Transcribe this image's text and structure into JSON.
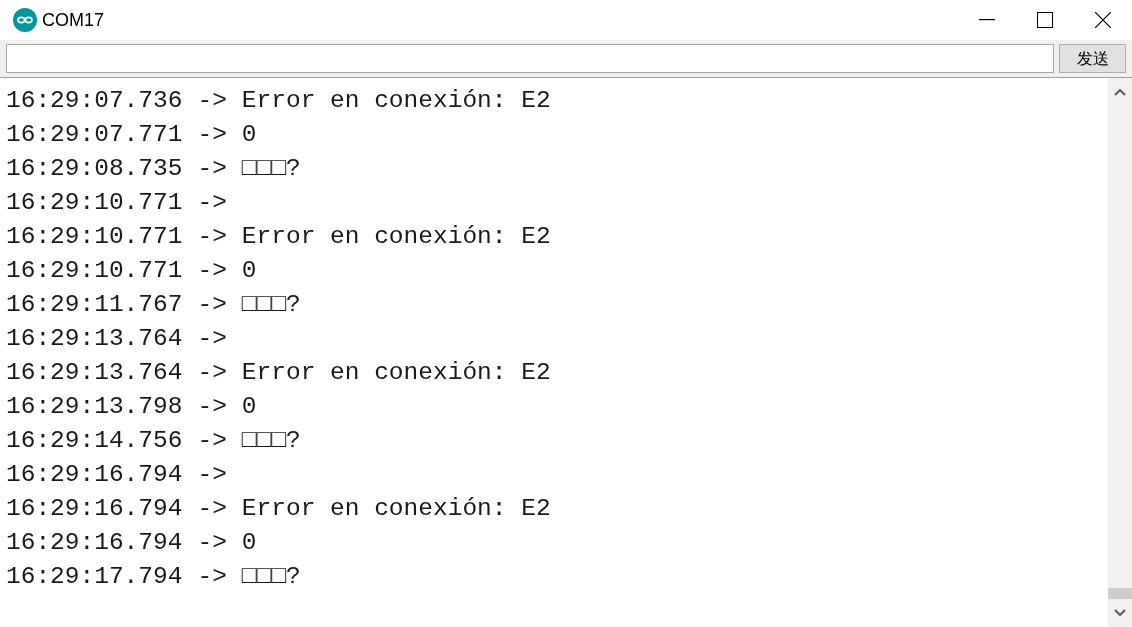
{
  "window": {
    "title": "COM17"
  },
  "send_button": {
    "label": "发送"
  },
  "lines": [
    {
      "time": "16:29:07.736",
      "arrow": "->",
      "message": "Error en conexión: E2"
    },
    {
      "time": "16:29:07.771",
      "arrow": "->",
      "message": "0"
    },
    {
      "time": "16:29:08.735",
      "arrow": "->",
      "message": "□□□?"
    },
    {
      "time": "16:29:10.771",
      "arrow": "->"
    },
    {
      "time": "16:29:10.771",
      "arrow": "->",
      "message": "Error en conexión: E2"
    },
    {
      "time": "16:29:10.771",
      "arrow": "->",
      "message": "0"
    },
    {
      "time": "16:29:11.767",
      "arrow": "->",
      "message": "□□□?"
    },
    {
      "time": "16:29:13.764",
      "arrow": "->"
    },
    {
      "time": "16:29:13.764",
      "arrow": "->",
      "message": "Error en conexión: E2"
    },
    {
      "time": "16:29:13.798",
      "arrow": "->",
      "message": "0"
    },
    {
      "time": "16:29:14.756",
      "arrow": "->",
      "message": "□□□?"
    },
    {
      "time": "16:29:16.794",
      "arrow": "->"
    },
    {
      "time": "16:29:16.794",
      "arrow": "->",
      "message": "Error en conexión: E2"
    },
    {
      "time": "16:29:16.794",
      "arrow": "->",
      "message": "0"
    },
    {
      "time": "16:29:17.794",
      "arrow": "->",
      "message": "□□□?"
    }
  ]
}
